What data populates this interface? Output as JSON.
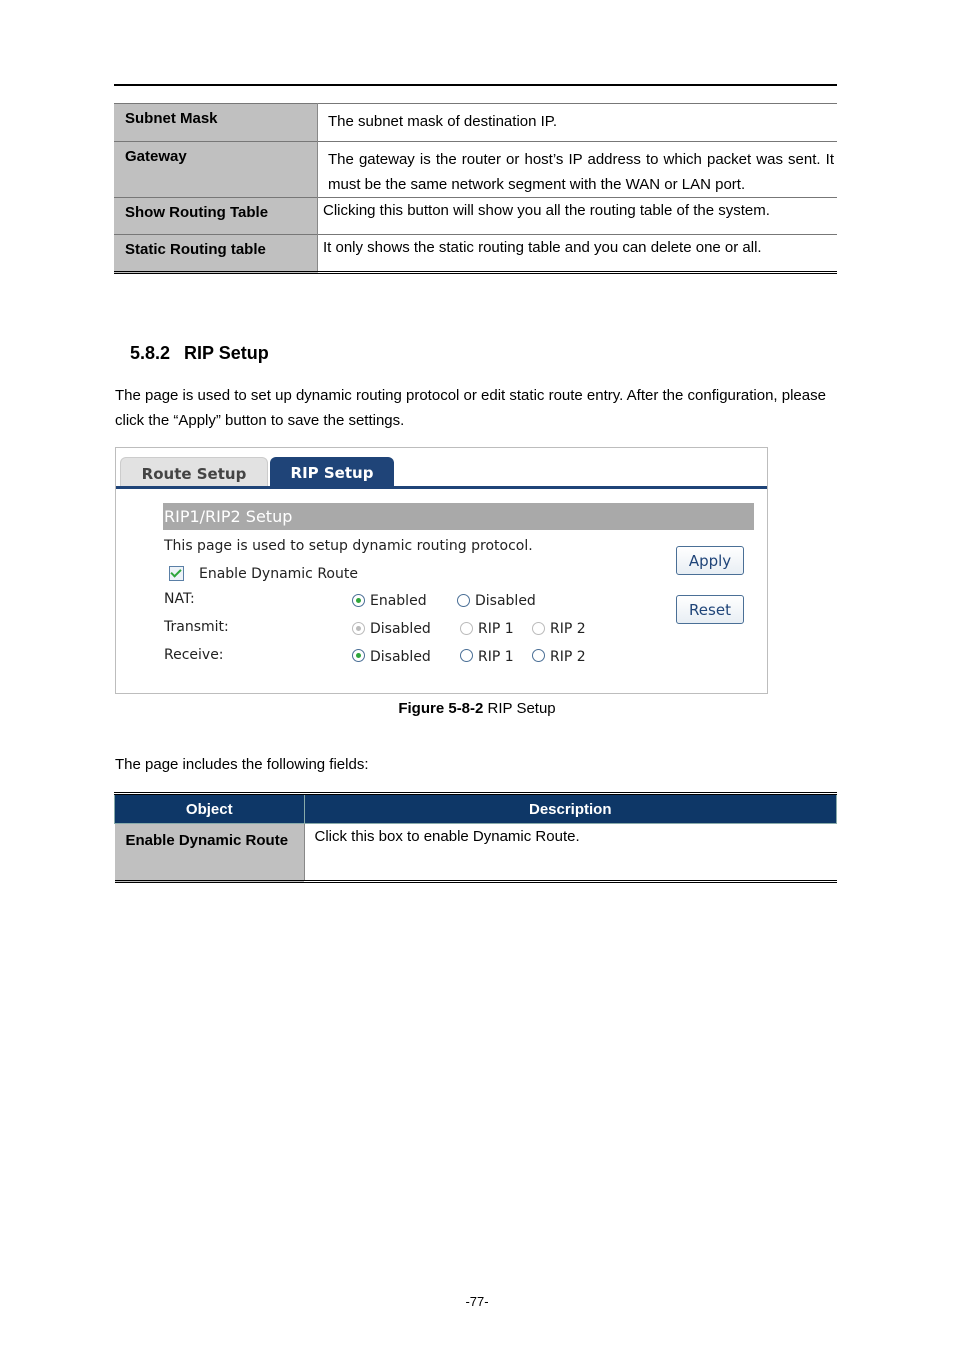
{
  "top_table": {
    "rows": [
      {
        "object": "Subnet Mask",
        "description": "The subnet mask of destination IP."
      },
      {
        "object": "Gateway",
        "description": "The gateway is the router or host’s IP address to which packet was sent. It must be the same network segment with the WAN or LAN port."
      },
      {
        "object": "Show Routing Table",
        "description": "Clicking this button will show you all the routing table of the system."
      },
      {
        "object": "Static Routing table",
        "description": "It only shows the static routing table and you can delete one or all."
      }
    ]
  },
  "section": {
    "number": "5.8.2",
    "title": "RIP Setup",
    "intro": "The page is used to set up dynamic routing protocol or edit static route entry. After the configuration, please click the “Apply” button to save the settings."
  },
  "screenshot": {
    "tabs": [
      {
        "label": "Route Setup",
        "active": false
      },
      {
        "label": "RIP Setup",
        "active": true
      }
    ],
    "section_title": "RIP1/RIP2 Setup",
    "description": "This page is used to setup dynamic routing protocol.",
    "enable_dynamic_route": {
      "label": "Enable Dynamic Route",
      "checked": true
    },
    "nat": {
      "label": "NAT:",
      "options": [
        "Enabled",
        "Disabled"
      ],
      "selected": "Enabled"
    },
    "transmit": {
      "label": "Transmit:",
      "options": [
        "Disabled",
        "RIP 1",
        "RIP 2"
      ],
      "selected": "Disabled",
      "disabled": true
    },
    "receive": {
      "label": "Receive:",
      "options": [
        "Disabled",
        "RIP 1",
        "RIP 2"
      ],
      "selected": "Disabled"
    },
    "apply_label": "Apply",
    "reset_label": "Reset"
  },
  "figure": {
    "label": "Figure 5-8-2",
    "title": "RIP Setup"
  },
  "fields_intro": "The page includes the following fields:",
  "fields_table": {
    "headers": [
      "Object",
      "Description"
    ],
    "rows": [
      {
        "object": "Enable Dynamic Route",
        "description": "Click this box to enable Dynamic Route."
      }
    ]
  },
  "page_number": "-77-"
}
